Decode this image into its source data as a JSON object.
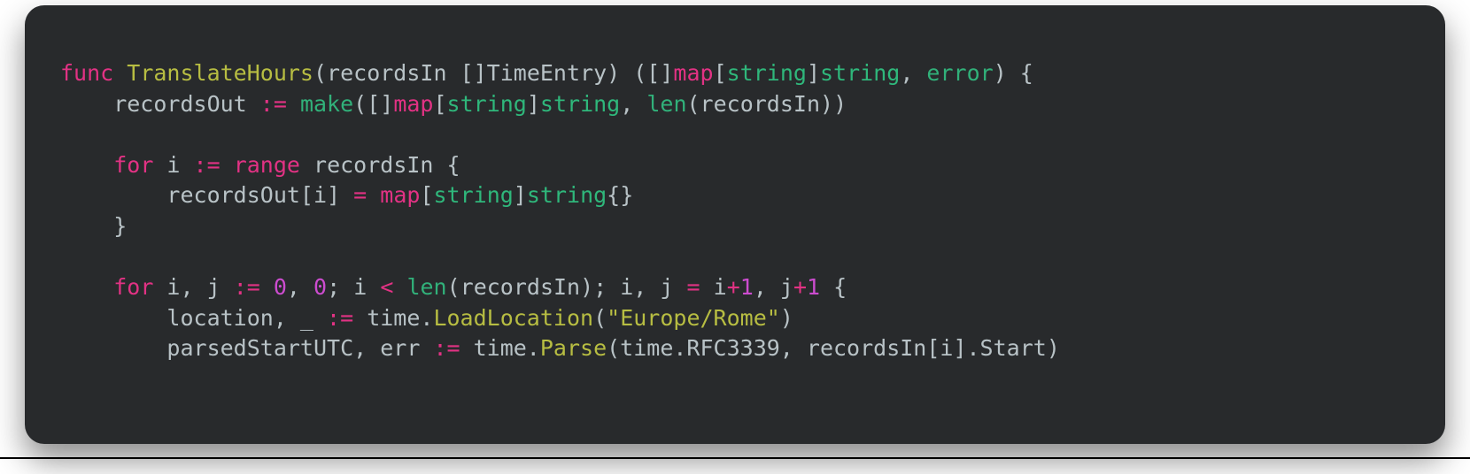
{
  "code": {
    "lines": [
      [
        {
          "t": "func ",
          "c": "tok-keyword"
        },
        {
          "t": "TranslateHours",
          "c": "tok-funcdecl"
        },
        {
          "t": "(",
          "c": "tok-punct"
        },
        {
          "t": "recordsIn",
          "c": "tok-ident"
        },
        {
          "t": " []",
          "c": "tok-punct"
        },
        {
          "t": "TimeEntry",
          "c": "tok-ident"
        },
        {
          "t": ") ([]",
          "c": "tok-punct"
        },
        {
          "t": "map",
          "c": "tok-keyword"
        },
        {
          "t": "[",
          "c": "tok-punct"
        },
        {
          "t": "string",
          "c": "tok-type"
        },
        {
          "t": "]",
          "c": "tok-punct"
        },
        {
          "t": "string",
          "c": "tok-type"
        },
        {
          "t": ", ",
          "c": "tok-punct"
        },
        {
          "t": "error",
          "c": "tok-builtin"
        },
        {
          "t": ") {",
          "c": "tok-punct"
        }
      ],
      [
        {
          "t": "    recordsOut ",
          "c": "tok-ident"
        },
        {
          "t": ":=",
          "c": "tok-define"
        },
        {
          "t": " ",
          "c": "tok-ident"
        },
        {
          "t": "make",
          "c": "tok-builtin"
        },
        {
          "t": "([]",
          "c": "tok-punct"
        },
        {
          "t": "map",
          "c": "tok-keyword"
        },
        {
          "t": "[",
          "c": "tok-punct"
        },
        {
          "t": "string",
          "c": "tok-type"
        },
        {
          "t": "]",
          "c": "tok-punct"
        },
        {
          "t": "string",
          "c": "tok-type"
        },
        {
          "t": ", ",
          "c": "tok-punct"
        },
        {
          "t": "len",
          "c": "tok-builtin"
        },
        {
          "t": "(recordsIn))",
          "c": "tok-punct"
        }
      ],
      [
        {
          "t": "",
          "c": "tok-ident"
        }
      ],
      [
        {
          "t": "    ",
          "c": "tok-ident"
        },
        {
          "t": "for",
          "c": "tok-keyword"
        },
        {
          "t": " i ",
          "c": "tok-ident"
        },
        {
          "t": ":=",
          "c": "tok-define"
        },
        {
          "t": " ",
          "c": "tok-ident"
        },
        {
          "t": "range",
          "c": "tok-keyword"
        },
        {
          "t": " recordsIn {",
          "c": "tok-ident"
        }
      ],
      [
        {
          "t": "        recordsOut[i] ",
          "c": "tok-ident"
        },
        {
          "t": "=",
          "c": "tok-opcolor"
        },
        {
          "t": " ",
          "c": "tok-ident"
        },
        {
          "t": "map",
          "c": "tok-keyword"
        },
        {
          "t": "[",
          "c": "tok-punct"
        },
        {
          "t": "string",
          "c": "tok-type"
        },
        {
          "t": "]",
          "c": "tok-punct"
        },
        {
          "t": "string",
          "c": "tok-type"
        },
        {
          "t": "{}",
          "c": "tok-punct"
        }
      ],
      [
        {
          "t": "    }",
          "c": "tok-ident"
        }
      ],
      [
        {
          "t": "",
          "c": "tok-ident"
        }
      ],
      [
        {
          "t": "    ",
          "c": "tok-ident"
        },
        {
          "t": "for",
          "c": "tok-keyword"
        },
        {
          "t": " i, j ",
          "c": "tok-ident"
        },
        {
          "t": ":=",
          "c": "tok-define"
        },
        {
          "t": " ",
          "c": "tok-ident"
        },
        {
          "t": "0",
          "c": "tok-number"
        },
        {
          "t": ", ",
          "c": "tok-punct"
        },
        {
          "t": "0",
          "c": "tok-number"
        },
        {
          "t": "; i ",
          "c": "tok-ident"
        },
        {
          "t": "<",
          "c": "tok-opcolor"
        },
        {
          "t": " ",
          "c": "tok-ident"
        },
        {
          "t": "len",
          "c": "tok-builtin"
        },
        {
          "t": "(recordsIn); i, j ",
          "c": "tok-ident"
        },
        {
          "t": "=",
          "c": "tok-opcolor"
        },
        {
          "t": " i",
          "c": "tok-ident"
        },
        {
          "t": "+",
          "c": "tok-opcolor"
        },
        {
          "t": "1",
          "c": "tok-number"
        },
        {
          "t": ", j",
          "c": "tok-ident"
        },
        {
          "t": "+",
          "c": "tok-opcolor"
        },
        {
          "t": "1",
          "c": "tok-number"
        },
        {
          "t": " {",
          "c": "tok-ident"
        }
      ],
      [
        {
          "t": "        location, _ ",
          "c": "tok-ident"
        },
        {
          "t": ":=",
          "c": "tok-define"
        },
        {
          "t": " time.",
          "c": "tok-ident"
        },
        {
          "t": "LoadLocation",
          "c": "tok-call"
        },
        {
          "t": "(",
          "c": "tok-punct"
        },
        {
          "t": "\"Europe/Rome\"",
          "c": "tok-string"
        },
        {
          "t": ")",
          "c": "tok-punct"
        }
      ],
      [
        {
          "t": "        parsedStartUTC, err ",
          "c": "tok-ident"
        },
        {
          "t": ":=",
          "c": "tok-define"
        },
        {
          "t": " time.",
          "c": "tok-ident"
        },
        {
          "t": "Parse",
          "c": "tok-call"
        },
        {
          "t": "(time.RFC3339, recordsIn[i].Start)",
          "c": "tok-ident"
        }
      ]
    ]
  }
}
